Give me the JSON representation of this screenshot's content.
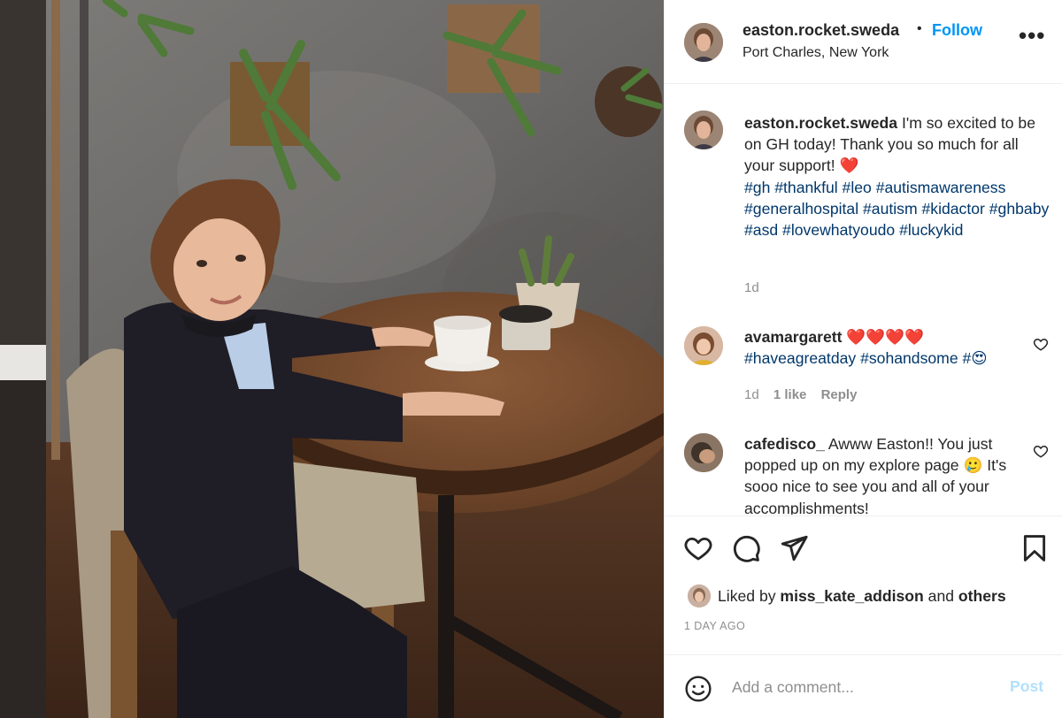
{
  "header": {
    "username": "easton.rocket.sweda",
    "separator": "•",
    "follow_label": "Follow",
    "location": "Port Charles, New York",
    "more_label": "•••"
  },
  "caption": {
    "username": "easton.rocket.sweda",
    "text": "I'm so excited to be on GH today! Thank you so much for all your support!",
    "emoji": "❤️",
    "hashtags": "#gh #thankful #leo #autismawareness #generalhospital #autism #kidactor #ghbaby #asd #lovewhatyoudo #luckykid",
    "time": "1d"
  },
  "comments": [
    {
      "username": "avamargarett",
      "text_emoji": "❤️❤️❤️❤️",
      "text": "#haveagreatday #sohandsome #😍",
      "time": "1d",
      "likes": "1 like",
      "reply_label": "Reply"
    },
    {
      "username": "cafedisco_",
      "text": "Awww Easton!! You just popped up on my explore page 🥲 It's sooo nice to see you and all of your accomplishments!"
    }
  ],
  "actions": {
    "liked_by_prefix": "Liked by",
    "liked_by_user": "miss_kate_addison",
    "liked_by_and": "and",
    "liked_by_others": "others",
    "post_time": "1 DAY AGO"
  },
  "add_comment": {
    "placeholder": "Add a comment...",
    "post_label": "Post"
  },
  "icons": {
    "more": "more-icon",
    "like": "heart-icon",
    "comment": "comment-icon",
    "share": "send-icon",
    "save": "bookmark-icon",
    "emoji": "smiley-icon"
  },
  "colors": {
    "follow": "#0095f6",
    "hashtag": "#00376b",
    "muted": "#8e8e8e",
    "post_disabled": "#b2dffc"
  }
}
